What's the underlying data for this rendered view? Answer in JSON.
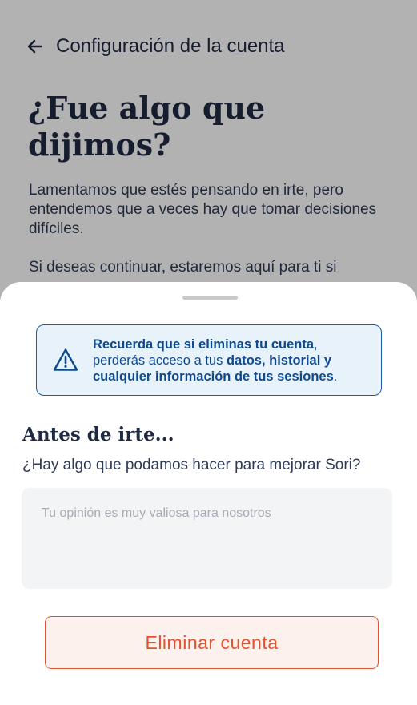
{
  "header": {
    "back_icon": "arrow-left-icon",
    "title": "Configuración de la cuenta"
  },
  "page": {
    "heading": "¿Fue algo que dijimos?",
    "paragraph_1": "Lamentamos que estés pensando en irte, pero entendemos que a veces hay que tomar decisiones difíciles.",
    "paragraph_2": "Si deseas continuar, estaremos aquí para ti si"
  },
  "sheet": {
    "alert": {
      "icon": "warning-triangle-icon",
      "part_1": "Recuerda que si eliminas tu cuenta",
      "part_2": ",",
      "part_3": " perderás acceso a tus ",
      "part_4": "datos, historial y cualquier información de tus sesiones",
      "part_5": "."
    },
    "section_title": "Antes de irte...",
    "section_subtitle": "¿Hay algo que podamos hacer para mejorar Sori?",
    "feedback_placeholder": "Tu opinión es muy valiosa para nosotros",
    "feedback_value": "",
    "delete_button": "Eliminar cuenta"
  },
  "colors": {
    "primary_dark": "#1f2a44",
    "alert_blue": "#0f4a8f",
    "alert_bg": "#e8f2fb",
    "danger": "#e0532e"
  }
}
